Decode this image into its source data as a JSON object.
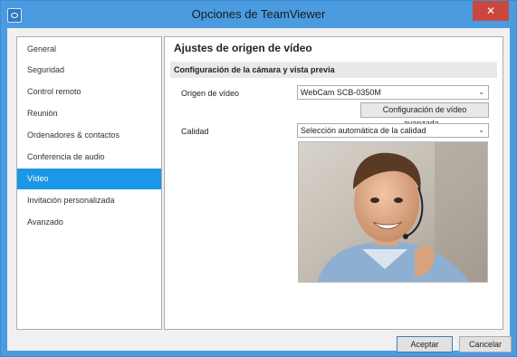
{
  "window": {
    "title": "Opciones de TeamViewer",
    "close_symbol": "✕",
    "accent_color": "#4a9be0",
    "close_color": "#c9473f"
  },
  "sidebar": {
    "items": [
      {
        "label": "General",
        "active": false
      },
      {
        "label": "Seguridad",
        "active": false
      },
      {
        "label": "Control remoto",
        "active": false
      },
      {
        "label": "Reunión",
        "active": false
      },
      {
        "label": "Ordenadores & contactos",
        "active": false
      },
      {
        "label": "Conferencia de audio",
        "active": false
      },
      {
        "label": "Vídeo",
        "active": true
      },
      {
        "label": "Invitación personalizada",
        "active": false
      },
      {
        "label": "Avanzado",
        "active": false
      }
    ],
    "selected_color": "#1a97e6"
  },
  "main": {
    "title": "Ajustes de origen de vídeo",
    "section_title": "Configuración de la cámara y vista previa",
    "video_source_label": "Origen de vídeo",
    "video_source_value": "WebCam SCB-0350M",
    "advanced_button": "Configuración de vídeo avanzada...",
    "quality_label": "Calidad",
    "quality_value": "Selección automática de la calidad"
  },
  "footer": {
    "ok_label": "Aceptar",
    "cancel_label": "Cancelar"
  }
}
